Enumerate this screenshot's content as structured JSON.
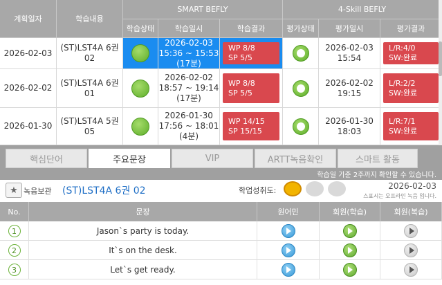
{
  "schedule": {
    "headers": {
      "plan_date": "계획일자",
      "content": "학습내용",
      "group1": "SMART BEFLY",
      "group2": "4-Skill BEFLY",
      "study_status": "학습상태",
      "study_time": "학습일시",
      "study_result": "학습결과",
      "eval_status": "평가상태",
      "eval_time": "평가일시",
      "eval_result": "평가결과"
    },
    "rows": [
      {
        "date": "2026-02-03",
        "content_l1": "(ST)LST4A 6권",
        "content_l2": "02",
        "time_l1": "2026-02-03",
        "time_l2": "15:36 ~ 15:53",
        "time_l3": "(17분)",
        "res_l1": "WP 8/8",
        "res_l2": "SP 5/5",
        "eval_l1": "2026-02-03",
        "eval_l2": "15:54",
        "evalres_l1": "L/R:4/0",
        "evalres_l2": "SW:완료"
      },
      {
        "date": "2026-02-02",
        "content_l1": "(ST)LST4A 6권",
        "content_l2": "01",
        "time_l1": "2026-02-02",
        "time_l2": "18:57 ~ 19:14",
        "time_l3": "(17분)",
        "res_l1": "WP 8/8",
        "res_l2": "SP 5/5",
        "eval_l1": "2026-02-02",
        "eval_l2": "19:15",
        "evalres_l1": "L/R:2/2",
        "evalres_l2": "SW:완료"
      },
      {
        "date": "2026-01-30",
        "content_l1": "(ST)LST4A 5권",
        "content_l2": "05",
        "time_l1": "2026-01-30",
        "time_l2": "17:56 ~ 18:01",
        "time_l3": "(4분)",
        "res_l1": "WP 14/15",
        "res_l2": "SP 15/15",
        "eval_l1": "2026-01-30",
        "eval_l2": "18:03",
        "evalres_l1": "L/R:7/1",
        "evalres_l2": "SW:완료"
      }
    ]
  },
  "tabs": {
    "items": [
      "핵심단어",
      "주요문장",
      "VIP",
      "ARTT녹음확인",
      "스마트 활동"
    ],
    "active_index": 1,
    "note": "학습일 기준 2주까지 확인할 수 있습니다."
  },
  "info": {
    "save_label": "녹음보관",
    "book_title": "(ST)LST4A 6권 02",
    "achievement_label": "학업성취도:",
    "date": "2026-02-03",
    "note": "스표시는 오프라인 녹음 입니다."
  },
  "sentences": {
    "headers": {
      "no": "No.",
      "sentence": "문장",
      "native": "원어민",
      "member_study": "회원(학습)",
      "member_review": "회원(복습)"
    },
    "rows": [
      {
        "no": "1",
        "text": "Jason`s party is today."
      },
      {
        "no": "2",
        "text": "It`s on the desk."
      },
      {
        "no": "3",
        "text": "Let`s get ready."
      }
    ]
  },
  "colors": {
    "header_gray": "#a8a8a8",
    "highlight_blue": "#1a8cf0",
    "result_red": "#d9484e",
    "title_blue": "#1f6fc6",
    "status_green": "#5fae2b"
  }
}
